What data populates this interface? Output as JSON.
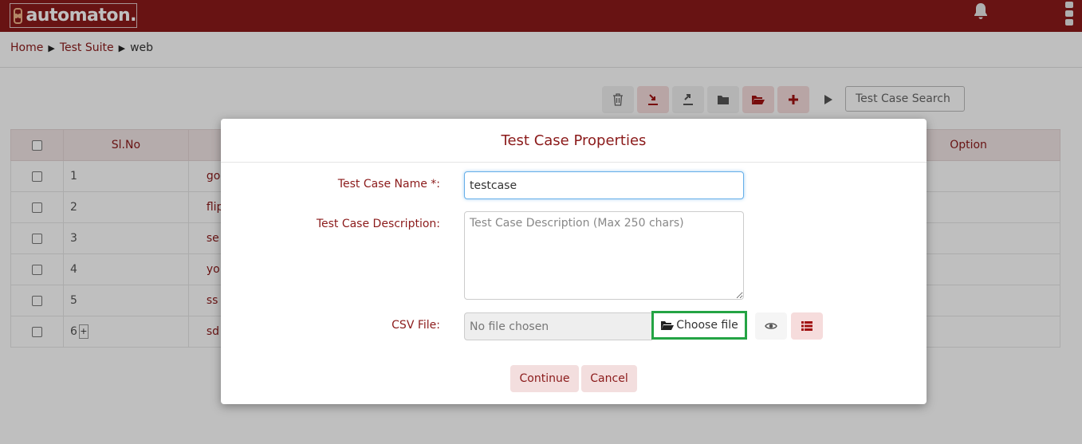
{
  "app": {
    "logo_text": "automaton."
  },
  "breadcrumb": {
    "home": "Home",
    "suite": "Test Suite",
    "current": "web",
    "separator": "▶"
  },
  "search": {
    "placeholder": "Test Case Search"
  },
  "table": {
    "headers": {
      "slno": "Sl.No",
      "option": "Option"
    },
    "rows": [
      {
        "slno": "1",
        "name": "go"
      },
      {
        "slno": "2",
        "name": "flip"
      },
      {
        "slno": "3",
        "name": "se"
      },
      {
        "slno": "4",
        "name": "yo"
      },
      {
        "slno": "5",
        "name": "ss"
      },
      {
        "slno": "6",
        "name": "sd",
        "expand": "+"
      }
    ]
  },
  "modal": {
    "title": "Test Case Properties",
    "name_label": "Test Case Name *:",
    "name_value": "testcase",
    "desc_label": "Test Case Description:",
    "desc_placeholder": "Test Case Description (Max 250 chars)",
    "csv_label": "CSV File:",
    "file_status": "No file chosen",
    "choose_label": "Choose file",
    "continue_label": "Continue",
    "cancel_label": "Cancel"
  },
  "colors": {
    "brand": "#8b1a1a",
    "highlight": "#24a444"
  },
  "icons": {
    "toolbar": [
      "trash-icon",
      "import-icon",
      "export-icon",
      "folder-icon",
      "folder-open-icon",
      "plus-icon",
      "play-icon"
    ],
    "header": [
      "bell-icon",
      "kebab-menu-icon"
    ]
  }
}
